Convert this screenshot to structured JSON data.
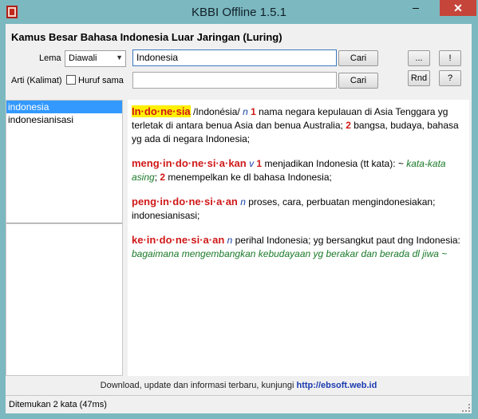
{
  "window": {
    "title": "KBBI Offline 1.5.1",
    "minimize": "–",
    "close": "✕"
  },
  "header": {
    "title": "Kamus Besar Bahasa Indonesia Luar Jaringan (Luring)"
  },
  "search": {
    "lema_label": "Lema",
    "mode_selected": "Diawali",
    "lema_value": "Indonesia",
    "cari_label": "Cari",
    "arti_label": "Arti (Kalimat)",
    "huruf_sama_label": "Huruf sama",
    "arti_value": "",
    "cari2_label": "Cari"
  },
  "tools": {
    "dots": "...",
    "excl": "!",
    "rnd": "Rnd",
    "help": "?"
  },
  "results": [
    {
      "label": "indonesia",
      "selected": true
    },
    {
      "label": "indonesianisasi",
      "selected": false
    }
  ],
  "definition": {
    "e1": {
      "headword": "In·do·ne·sia",
      "pron": " /Indonésia/ ",
      "cls": "n",
      "n1": "1",
      "d1": " nama negara kepulauan di Asia Tenggara yg terletak di antara benua Asia dan benua Australia; ",
      "n2": "2",
      "d2": " bangsa, budaya, bahasa yg ada di negara Indonesia;"
    },
    "e2": {
      "headword": "meng·in·do·ne·si·a·kan",
      "cls": "v",
      "n1": "1",
      "d1": " menjadikan Indonesia (tt kata): ~ ",
      "ex1": "kata-kata asing",
      "sep": "; ",
      "n2": "2",
      "d2": " menempelkan ke dl bahasa Indonesia;"
    },
    "e3": {
      "headword": "peng·in·do·ne·si·a·an",
      "cls": "n",
      "d1": " proses, cara, perbuatan mengindonesiakan; indonesianisasi;"
    },
    "e4": {
      "headword": "ke·in·do·ne·si·a·an",
      "cls": "n",
      "d1": " perihal Indonesia; yg bersangkut paut dng Indonesia: ",
      "ex1": "bagaimana mengembangkan kebudayaan yg berakar dan berada dl jiwa ~"
    }
  },
  "footer": {
    "text": "Download, update dan informasi terbaru, kunjungi ",
    "link": "http://ebsoft.web.id"
  },
  "status": {
    "text": "Ditemukan 2 kata (47ms)"
  },
  "colors": {
    "title_bg": "#7cb8c0",
    "close_bg": "#c6453a",
    "headword": "#d01818",
    "class": "#1840a8",
    "example": "#1a7a28",
    "highlight": "#ffef00",
    "selection": "#3399ff"
  }
}
